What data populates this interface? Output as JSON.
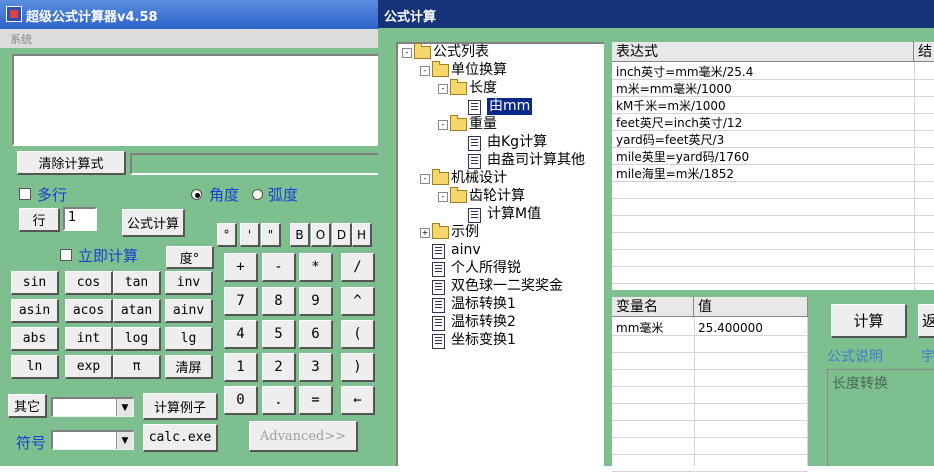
{
  "left_window": {
    "title": "超级公式计算器v4.58",
    "menu": "系统",
    "clear_label": "清除计算式",
    "multiline_label": "多行",
    "degree_label": "角度",
    "radian_label": "弧度",
    "row_label": "行",
    "row_value": "1",
    "formula_calc_label": "公式计算",
    "base_buttons": [
      "°",
      "'",
      "\"",
      "B",
      "O",
      "D",
      "H"
    ],
    "instant_calc_label": "立即计算",
    "degree_button": "度°",
    "func_rows": [
      [
        "sin",
        "cos",
        "tan",
        "inv"
      ],
      [
        "asin",
        "acos",
        "atan",
        "ainv"
      ],
      [
        "abs",
        "int",
        "log",
        "lg"
      ],
      [
        "ln",
        "exp",
        "π",
        "清屏"
      ]
    ],
    "keypad_rows": [
      [
        "+",
        "-",
        "*",
        "/"
      ],
      [
        "7",
        "8",
        "9",
        "^"
      ],
      [
        "4",
        "5",
        "6",
        "("
      ],
      [
        "1",
        "2",
        "3",
        ")"
      ],
      [
        "0",
        ".",
        "=",
        "←"
      ]
    ],
    "other_label": "其它",
    "example_label": "计算例子",
    "symbol_label": "符号",
    "calc_exe_label": "calc.exe",
    "advanced_label": "Advanced>>"
  },
  "right_window": {
    "title": "公式计算",
    "tree": [
      {
        "label": "公式列表",
        "level": 0,
        "kind": "folder",
        "toggle": "-"
      },
      {
        "label": "单位换算",
        "level": 1,
        "kind": "folder",
        "toggle": "-"
      },
      {
        "label": "长度",
        "level": 2,
        "kind": "folder",
        "toggle": "-"
      },
      {
        "label": "由mm",
        "level": 3,
        "kind": "doc",
        "selected": true
      },
      {
        "label": "重量",
        "level": 2,
        "kind": "folder",
        "toggle": "-"
      },
      {
        "label": "由Kg计算",
        "level": 3,
        "kind": "doc"
      },
      {
        "label": "由盎司计算其他",
        "level": 3,
        "kind": "doc"
      },
      {
        "label": "机械设计",
        "level": 1,
        "kind": "folder",
        "toggle": "-"
      },
      {
        "label": "齿轮计算",
        "level": 2,
        "kind": "folder",
        "toggle": "-"
      },
      {
        "label": "计算M值",
        "level": 3,
        "kind": "doc"
      },
      {
        "label": "示例",
        "level": 1,
        "kind": "folder",
        "toggle": "+"
      },
      {
        "label": "ainv",
        "level": 1,
        "kind": "doc"
      },
      {
        "label": "个人所得锐",
        "level": 1,
        "kind": "doc"
      },
      {
        "label": "双色球一二奖奖金",
        "level": 1,
        "kind": "doc"
      },
      {
        "label": "温标转换1",
        "level": 1,
        "kind": "doc"
      },
      {
        "label": "温标转换2",
        "level": 1,
        "kind": "doc"
      },
      {
        "label": "坐标变换1",
        "level": 1,
        "kind": "doc"
      }
    ],
    "expr_header": "表达式",
    "result_header": "结",
    "expressions": [
      "inch英寸=mm毫米/25.4",
      "m米=mm毫米/1000",
      "kM千米=m米/1000",
      "feet英尺=inch英寸/12",
      "yard码=feet英尺/3",
      "mile英里=yard码/1760",
      "mile海里=m米/1852"
    ],
    "var_header": "变量名",
    "value_header": "值",
    "variables": [
      {
        "name": "mm毫米",
        "value": "25.400000"
      }
    ],
    "calc_button": "计算",
    "return_button": "返",
    "desc_label": "公式说明",
    "desc_label2": "宇",
    "description": "长度转换"
  },
  "colors": {
    "window_bg": "#7dbf8e",
    "left_title": "#2f63c8",
    "right_title": "#16337a",
    "accent_text": "#1a3fd6",
    "selection": "#0a2a8a"
  }
}
